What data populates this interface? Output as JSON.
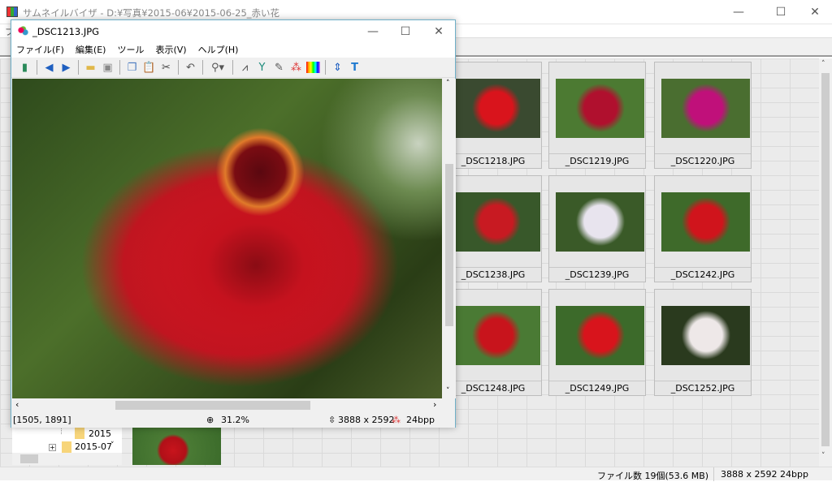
{
  "main": {
    "title": "サムネイルバイザ - D:¥写真¥2015-06¥2015-06-25_赤い花",
    "menu_first": "フ",
    "thumbnails": [
      {
        "name": "_DSC1218.JPG",
        "color": "#d9141c",
        "bg": "#3a4a30"
      },
      {
        "name": "_DSC1219.JPG",
        "color": "#b0102e",
        "bg": "#4c7a32"
      },
      {
        "name": "_DSC1220.JPG",
        "color": "#c0107a",
        "bg": "#4a6e30"
      },
      {
        "name": "_DSC1238.JPG",
        "color": "#c81a22",
        "bg": "#38582a"
      },
      {
        "name": "_DSC1239.JPG",
        "color": "#e8e4ee",
        "bg": "#3a5a28"
      },
      {
        "name": "_DSC1242.JPG",
        "color": "#d0141c",
        "bg": "#3e6a2a"
      },
      {
        "name": "_DSC1248.JPG",
        "color": "#c8141c",
        "bg": "#4a7a34"
      },
      {
        "name": "_DSC1249.JPG",
        "color": "#d8141c",
        "bg": "#3c6a2a"
      },
      {
        "name": "_DSC1252.JPG",
        "color": "#eee8e8",
        "bg": "#2a3a1e"
      }
    ],
    "tree": [
      {
        "label": "2015"
      },
      {
        "label": "2015-07"
      }
    ],
    "status": {
      "file_count": "ファイル数 19個(53.6 MB)",
      "image_info": "3888 x 2592 24bpp"
    }
  },
  "viewer": {
    "title": "_DSC1213.JPG",
    "menu": [
      "ファイル(F)",
      "編集(E)",
      "ツール",
      "表示(V)",
      "ヘルプ(H)"
    ],
    "toolbar": [
      "exit",
      "back",
      "forward",
      "open",
      "save",
      "copy",
      "paste",
      "cut",
      "undo",
      "zoom",
      "histogram",
      "levels",
      "sharpen",
      "color-balance",
      "palette",
      "resize",
      "text"
    ],
    "status": {
      "coords": "[1505, 1891]",
      "zoom": "31.2%",
      "size": "3888 x 2592",
      "depth": "24bpp"
    }
  }
}
